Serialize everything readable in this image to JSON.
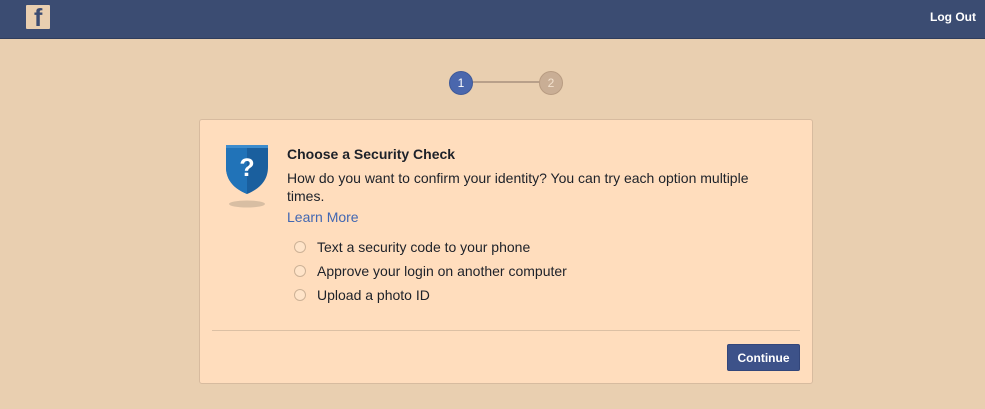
{
  "header": {
    "logo_icon": "facebook-f-icon",
    "logout_label": "Log Out",
    "background_color": "#3b4c72"
  },
  "stepper": {
    "steps": [
      {
        "label": "1",
        "state": "active"
      },
      {
        "label": "2",
        "state": "inactive"
      }
    ],
    "active_color": "#4a67ad"
  },
  "security_check": {
    "icon": "shield-question-icon",
    "title": "Choose a Security Check",
    "description": "How do you want to confirm your identity? You can try each option multiple times.",
    "learn_more": "Learn More",
    "options": [
      {
        "label": "Text a security code to your phone",
        "selected": false
      },
      {
        "label": "Approve your login on another computer",
        "selected": false
      },
      {
        "label": "Upload a photo ID",
        "selected": false
      }
    ],
    "continue_label": "Continue"
  },
  "colors": {
    "page_background": "#e9cfb0",
    "card_background": "#ffddbd",
    "link": "#4267b2",
    "primary_button": "#3d5289"
  }
}
